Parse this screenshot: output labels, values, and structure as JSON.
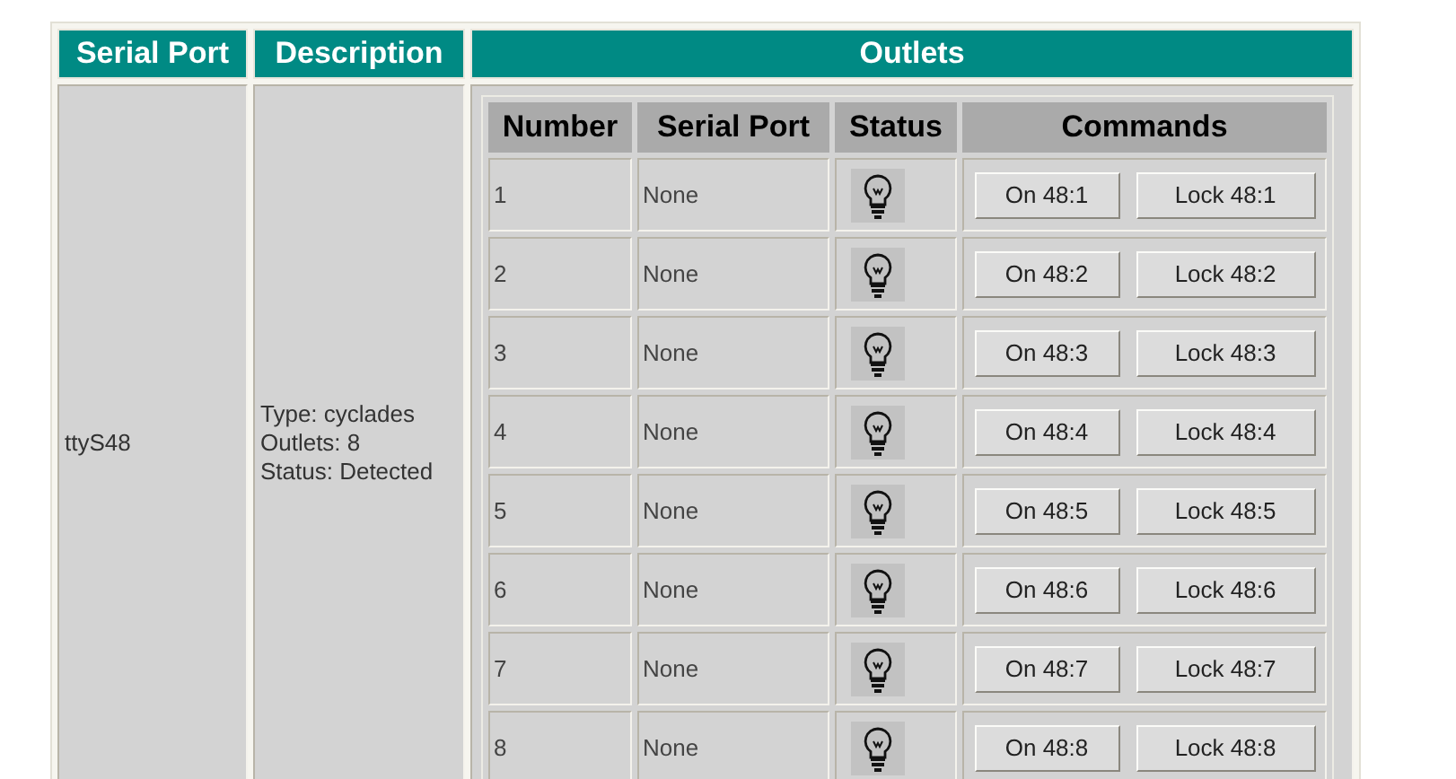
{
  "table": {
    "columns": [
      "Serial Port",
      "Description",
      "Outlets"
    ],
    "rows": [
      {
        "serial_port": "ttyS48",
        "description": [
          "Type: cyclades",
          "Outlets: 8",
          "Status: Detected"
        ],
        "outlets": {
          "columns": [
            "Number",
            "Serial Port",
            "Status",
            "Commands"
          ],
          "rows": [
            {
              "number": "1",
              "serial_port": "None",
              "on_button": "On 48:1",
              "lock_button": "Lock 48:1"
            },
            {
              "number": "2",
              "serial_port": "None",
              "on_button": "On 48:2",
              "lock_button": "Lock 48:2"
            },
            {
              "number": "3",
              "serial_port": "None",
              "on_button": "On 48:3",
              "lock_button": "Lock 48:3"
            },
            {
              "number": "4",
              "serial_port": "None",
              "on_button": "On 48:4",
              "lock_button": "Lock 48:4"
            },
            {
              "number": "5",
              "serial_port": "None",
              "on_button": "On 48:5",
              "lock_button": "Lock 48:5"
            },
            {
              "number": "6",
              "serial_port": "None",
              "on_button": "On 48:6",
              "lock_button": "Lock 48:6"
            },
            {
              "number": "7",
              "serial_port": "None",
              "on_button": "On 48:7",
              "lock_button": "Lock 48:7"
            },
            {
              "number": "8",
              "serial_port": "None",
              "on_button": "On 48:8",
              "lock_button": "Lock 48:8"
            }
          ]
        }
      }
    ]
  }
}
